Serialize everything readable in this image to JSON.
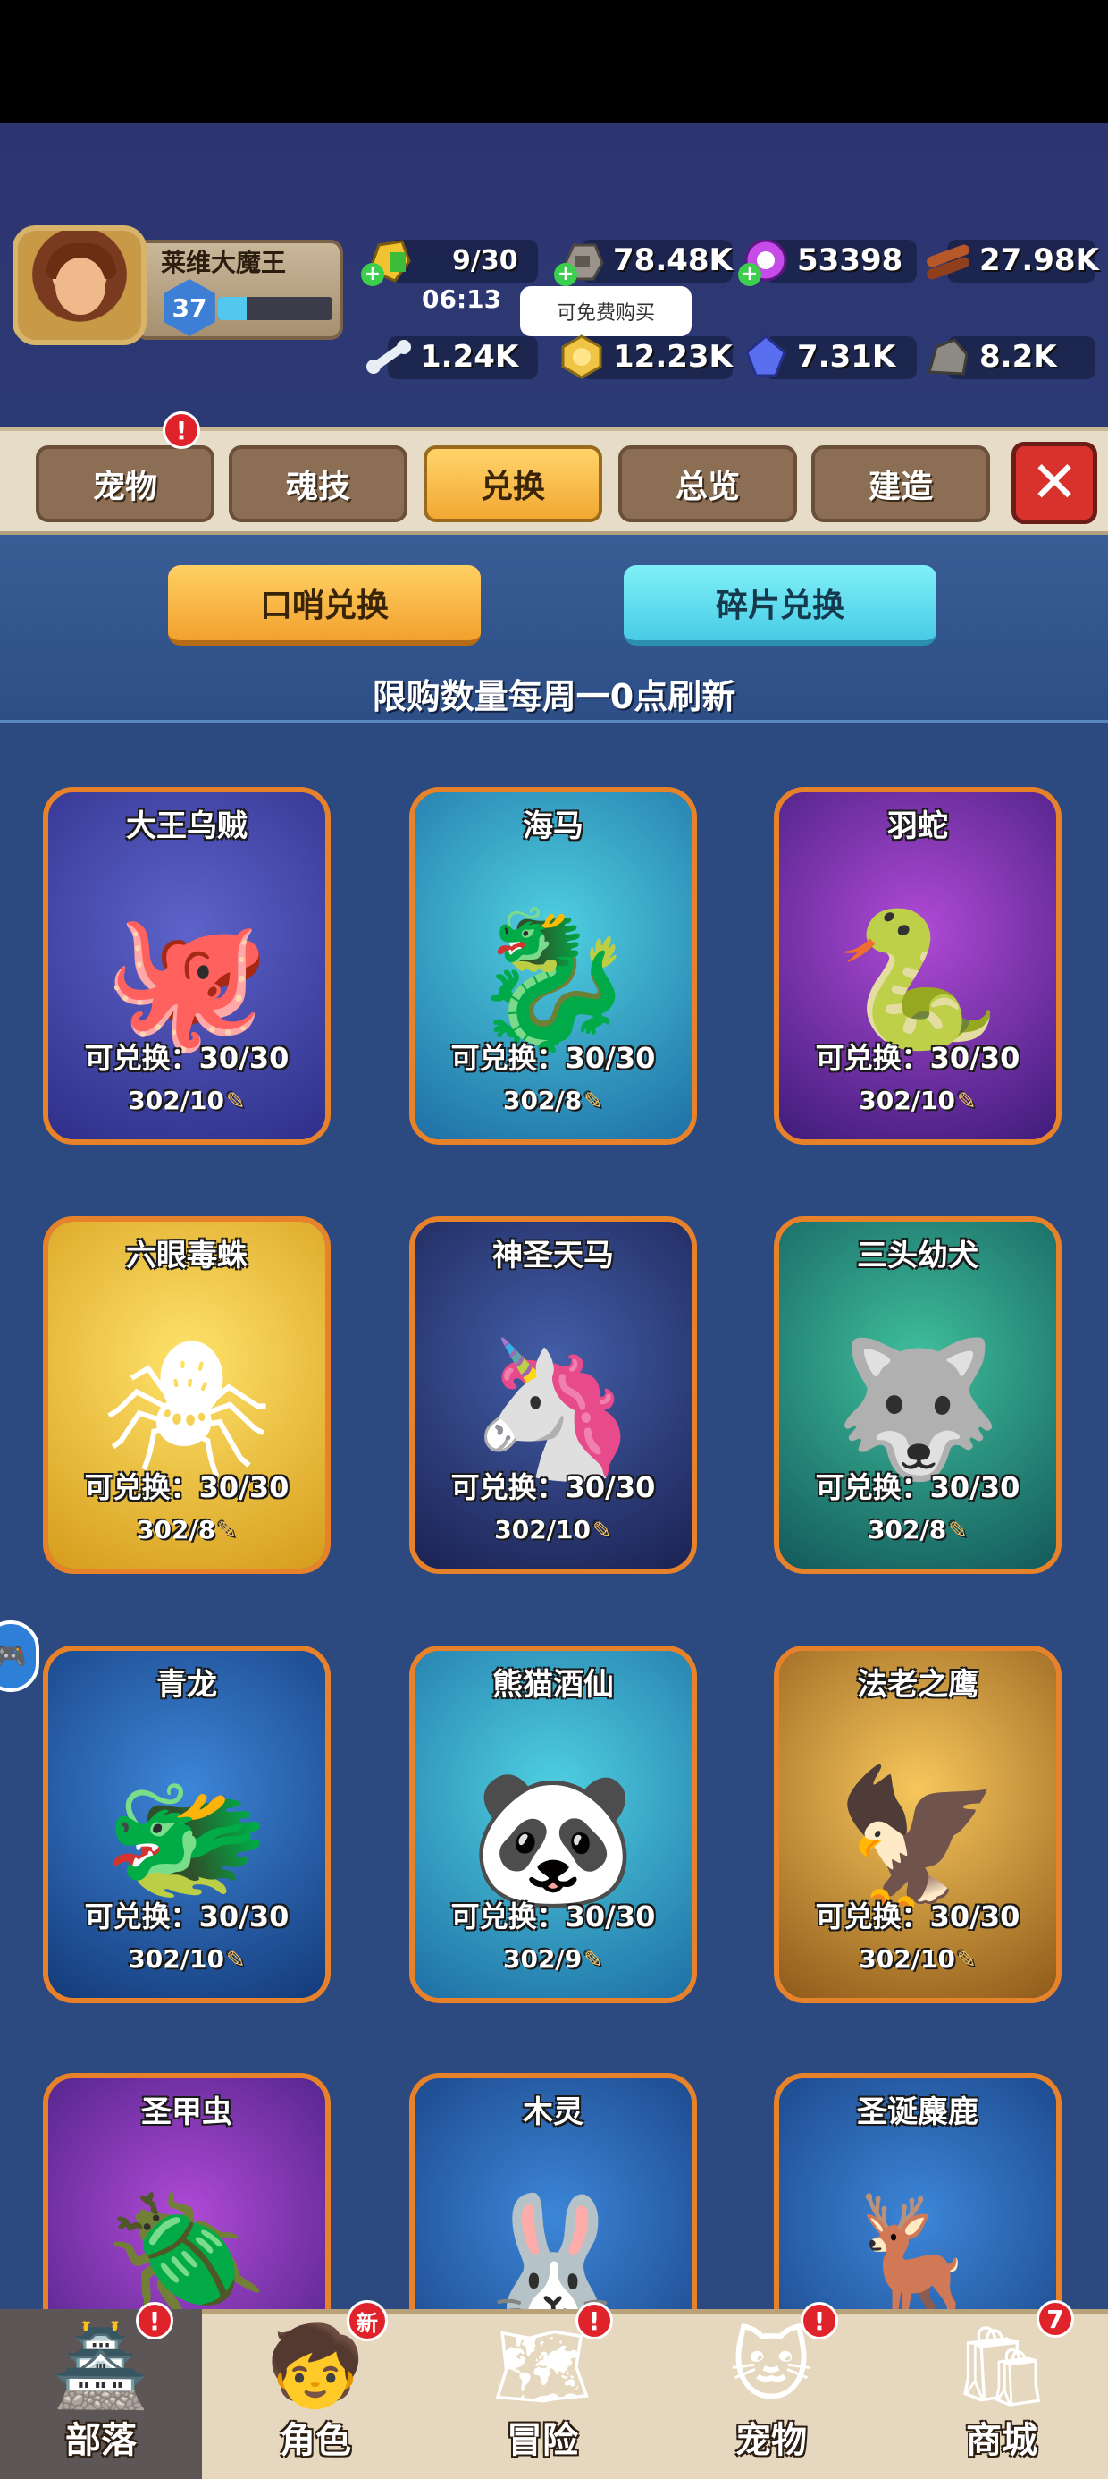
{
  "player": {
    "name": "莱维大魔王",
    "level": "37",
    "xp_fraction": 0.25
  },
  "resources": {
    "stamina": {
      "value": "9/30",
      "timer": "06:13",
      "icon": "stamina-pouch-icon"
    },
    "stone": {
      "value": "78.48K",
      "icon": "stone-ore-icon"
    },
    "gem": {
      "value": "53398",
      "icon": "purple-gem-icon"
    },
    "wood": {
      "value": "27.98K",
      "icon": "wood-log-icon"
    },
    "bone": {
      "value": "1.24K",
      "icon": "bone-icon"
    },
    "coin": {
      "value": "12.23K",
      "icon": "gold-coin-icon"
    },
    "crystal": {
      "value": "7.31K",
      "icon": "blue-crystal-icon"
    },
    "iron": {
      "value": "8.2K",
      "icon": "iron-ore-icon"
    }
  },
  "tooltip": "可免费购买",
  "tabs": [
    {
      "label": "宠物",
      "active": false,
      "badge": "!"
    },
    {
      "label": "魂技",
      "active": false
    },
    {
      "label": "兑换",
      "active": true
    },
    {
      "label": "总览",
      "active": false
    },
    {
      "label": "建造",
      "active": false
    }
  ],
  "close_icon": "close-x-icon",
  "exchange": {
    "whistle_button": "口哨兑换",
    "shard_button": "碎片兑换",
    "notice": "限购数量每周一0点刷新"
  },
  "pets": [
    {
      "name": "大王乌贼",
      "available": "可兑换：30/30",
      "cost": "302/10",
      "icon": "octopus-icon"
    },
    {
      "name": "海马",
      "available": "可兑换：30/30",
      "cost": "302/8",
      "icon": "seahorse-icon"
    },
    {
      "name": "羽蛇",
      "available": "可兑换：30/30",
      "cost": "302/10",
      "icon": "feathered-serpent-icon"
    },
    {
      "name": "六眼毒蛛",
      "available": "可兑换：30/30",
      "cost": "302/8",
      "icon": "spider-icon"
    },
    {
      "name": "神圣天马",
      "available": "可兑换：30/30",
      "cost": "302/10",
      "icon": "pegasus-icon"
    },
    {
      "name": "三头幼犬",
      "available": "可兑换：30/30",
      "cost": "302/8",
      "icon": "three-headed-dog-icon"
    },
    {
      "name": "青龙",
      "available": "可兑换：30/30",
      "cost": "302/10",
      "icon": "azure-dragon-icon"
    },
    {
      "name": "熊猫酒仙",
      "available": "可兑换：30/30",
      "cost": "302/9",
      "icon": "panda-icon"
    },
    {
      "name": "法老之鹰",
      "available": "可兑换：30/30",
      "cost": "302/10",
      "icon": "pharaoh-eagle-icon"
    },
    {
      "name": "圣甲虫",
      "icon": "scarab-icon"
    },
    {
      "name": "木灵",
      "icon": "wood-spirit-icon"
    },
    {
      "name": "圣诞麋鹿",
      "icon": "christmas-reindeer-icon"
    }
  ],
  "nav": [
    {
      "label": "部落",
      "active": true,
      "badge": "!",
      "icon": "tribe-totem-icon"
    },
    {
      "label": "角色",
      "active": false,
      "badge": "新",
      "icon": "character-icon"
    },
    {
      "label": "冒险",
      "active": false,
      "badge": "!",
      "icon": "adventure-map-icon"
    },
    {
      "label": "宠物",
      "active": false,
      "badge": "!",
      "icon": "pet-icon"
    },
    {
      "label": "商城",
      "active": false,
      "badge": "7",
      "icon": "shop-bag-icon"
    }
  ]
}
